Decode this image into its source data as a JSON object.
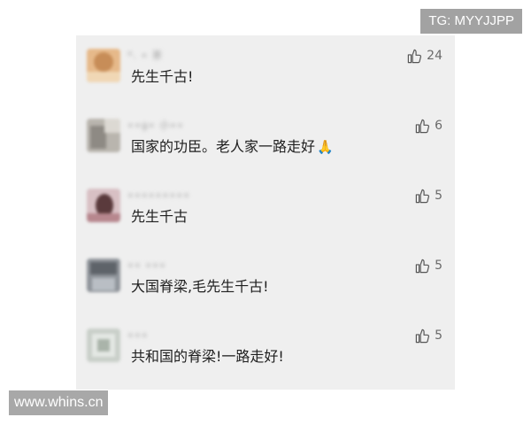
{
  "watermarks": {
    "telegram": "TG: MYYJJPP",
    "site": "www.whins.cn"
  },
  "comments": [
    {
      "username": "*. ∙ 茶",
      "text": "先生千古!",
      "likes": "24"
    },
    {
      "username": "∙∙g∙ 小∙∙",
      "text": "国家的功臣。老人家一路走好",
      "emoji": "🙏",
      "likes": "6"
    },
    {
      "username": "∙∙∙∙∙∙∙∙∙",
      "text": "先生千古",
      "likes": "5"
    },
    {
      "username": "∙∙ ∙∙∙",
      "text": "大国脊梁,毛先生千古!",
      "likes": "5"
    },
    {
      "username": "∙∙∙",
      "text": "共和国的脊梁!一路走好!",
      "likes": "5"
    }
  ]
}
